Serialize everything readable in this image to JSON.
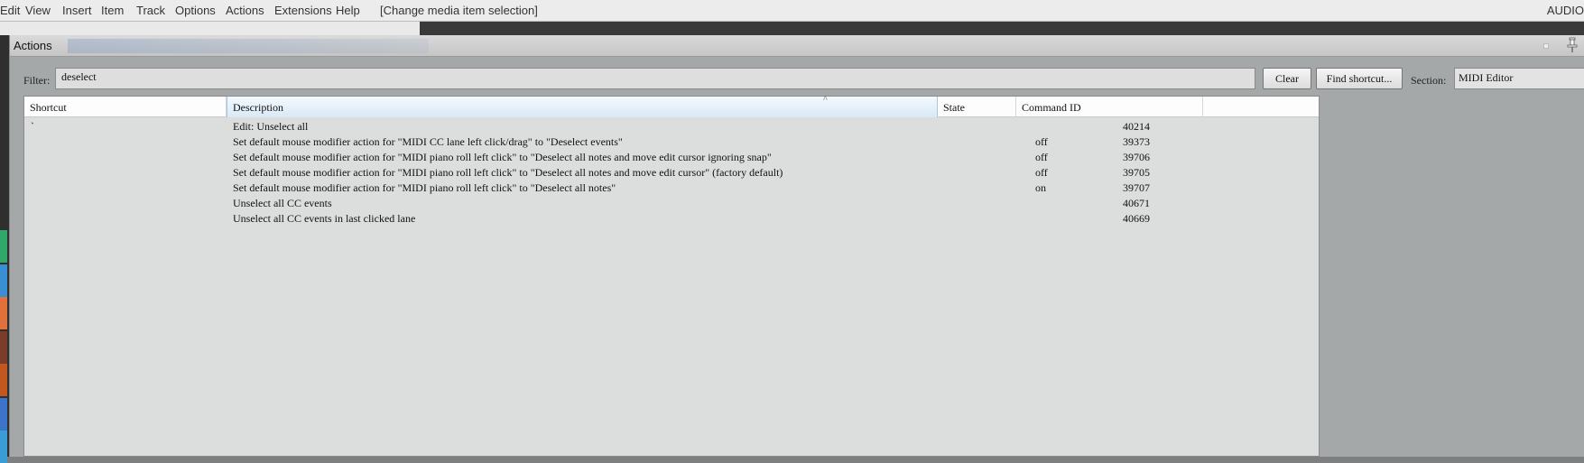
{
  "menubar": {
    "items": [
      "Edit",
      "View",
      "Insert",
      "Item",
      "Track",
      "Options",
      "Actions",
      "Extensions",
      "Help"
    ],
    "status": "[Change media item selection]",
    "right": "AUDIO"
  },
  "dialog": {
    "title": "Actions",
    "filter_label": "Filter:",
    "filter_value": "deselect",
    "clear_label": "Clear",
    "find_shortcut_label": "Find shortcut...",
    "section_label": "Section:",
    "section_value": "MIDI Editor"
  },
  "table": {
    "columns": [
      "Shortcut",
      "Description",
      "State",
      "Command ID"
    ],
    "sort_indicator": "^",
    "rows": [
      {
        "shortcut": "`",
        "description": "Edit: Unselect all",
        "state": "",
        "command_id": "40214"
      },
      {
        "shortcut": "",
        "description": "Set default mouse modifier action for \"MIDI CC lane left click/drag\" to \"Deselect events\"",
        "state": "off",
        "command_id": "39373"
      },
      {
        "shortcut": "",
        "description": "Set default mouse modifier action for \"MIDI piano roll left click\" to \"Deselect all notes and move edit cursor ignoring snap\"",
        "state": "off",
        "command_id": "39706"
      },
      {
        "shortcut": "",
        "description": "Set default mouse modifier action for \"MIDI piano roll left click\" to \"Deselect all notes and move edit cursor\" (factory default)",
        "state": "off",
        "command_id": "39705"
      },
      {
        "shortcut": "",
        "description": "Set default mouse modifier action for \"MIDI piano roll left click\" to \"Deselect all notes\"",
        "state": "on",
        "command_id": "39707"
      },
      {
        "shortcut": "",
        "description": "Unselect all CC events",
        "state": "",
        "command_id": "40671"
      },
      {
        "shortcut": "",
        "description": "Unselect all CC events in last clicked lane",
        "state": "",
        "command_id": "40669"
      }
    ]
  },
  "colors": {
    "header_sorted": "#d9e9f6",
    "table_bg": "#dcdedd",
    "dialog_bg": "#a5a8a9"
  },
  "icons": {
    "pin": "pin-icon"
  }
}
